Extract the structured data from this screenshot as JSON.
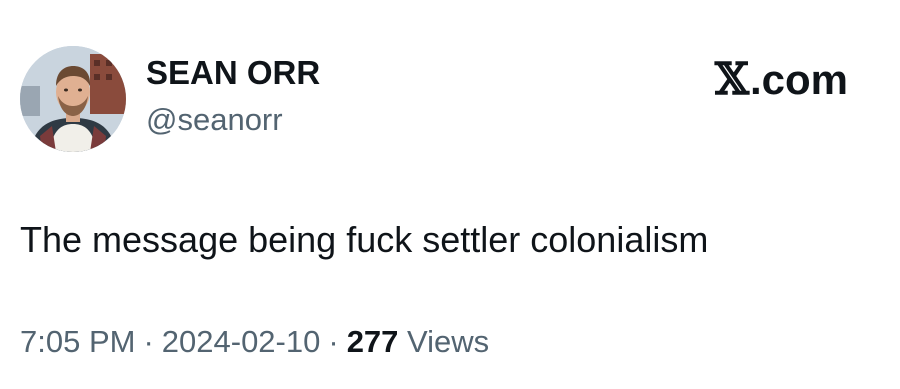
{
  "author": {
    "display_name": "SEAN ORR",
    "handle": "@seanorr",
    "avatar_icon": "profile-photo"
  },
  "brand": {
    "x_glyph": "𝕏",
    "domain": ".com"
  },
  "tweet": {
    "text": "The message being fuck settler colonialism"
  },
  "meta": {
    "time": "7:05 PM",
    "separator": "·",
    "date": "2024-02-10",
    "views_count": "277",
    "views_label": "Views"
  },
  "colors": {
    "text_primary": "#0f1419",
    "text_secondary": "#536471",
    "background": "#ffffff"
  }
}
